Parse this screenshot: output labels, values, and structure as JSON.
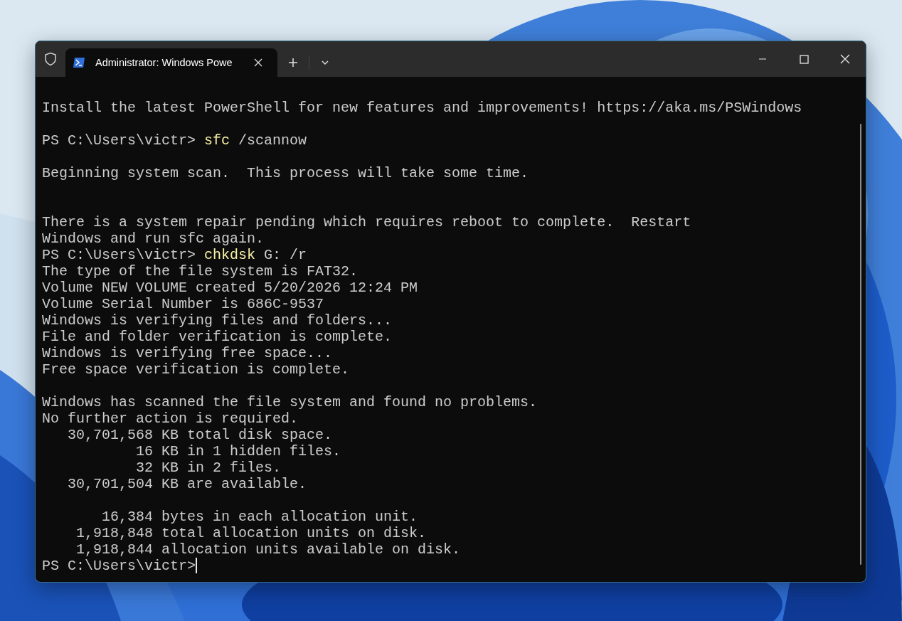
{
  "window": {
    "tabs": [
      {
        "title": "Administrator: Windows Powe",
        "selected": true
      }
    ]
  },
  "terminal": {
    "lines": [
      {
        "kind": "output",
        "text": "Install the latest PowerShell for new features and improvements! https://aka.ms/PSWindows"
      },
      {
        "kind": "blank"
      },
      {
        "kind": "command",
        "prompt": "PS C:\\Users\\victr>",
        "command": "sfc",
        "args": "/scannow"
      },
      {
        "kind": "blank"
      },
      {
        "kind": "output",
        "text": "Beginning system scan.  This process will take some time."
      },
      {
        "kind": "blank"
      },
      {
        "kind": "blank"
      },
      {
        "kind": "output",
        "text": "There is a system repair pending which requires reboot to complete.  Restart"
      },
      {
        "kind": "output",
        "text": "Windows and run sfc again."
      },
      {
        "kind": "command",
        "prompt": "PS C:\\Users\\victr>",
        "command": "chkdsk",
        "args": "G: /r"
      },
      {
        "kind": "output",
        "text": "The type of the file system is FAT32."
      },
      {
        "kind": "output",
        "text": "Volume NEW VOLUME created 5/20/2026 12:24 PM"
      },
      {
        "kind": "output",
        "text": "Volume Serial Number is 686C-9537"
      },
      {
        "kind": "output",
        "text": "Windows is verifying files and folders..."
      },
      {
        "kind": "output",
        "text": "File and folder verification is complete."
      },
      {
        "kind": "output",
        "text": "Windows is verifying free space..."
      },
      {
        "kind": "output",
        "text": "Free space verification is complete."
      },
      {
        "kind": "blank"
      },
      {
        "kind": "output",
        "text": "Windows has scanned the file system and found no problems."
      },
      {
        "kind": "output",
        "text": "No further action is required."
      },
      {
        "kind": "output",
        "text": "   30,701,568 KB total disk space."
      },
      {
        "kind": "output",
        "text": "           16 KB in 1 hidden files."
      },
      {
        "kind": "output",
        "text": "           32 KB in 2 files."
      },
      {
        "kind": "output",
        "text": "   30,701,504 KB are available."
      },
      {
        "kind": "blank"
      },
      {
        "kind": "output",
        "text": "       16,384 bytes in each allocation unit."
      },
      {
        "kind": "output",
        "text": "    1,918,848 total allocation units on disk."
      },
      {
        "kind": "output",
        "text": "    1,918,844 allocation units available on disk."
      },
      {
        "kind": "prompt",
        "prompt": "PS C:\\Users\\victr>",
        "cursor": true
      }
    ]
  }
}
